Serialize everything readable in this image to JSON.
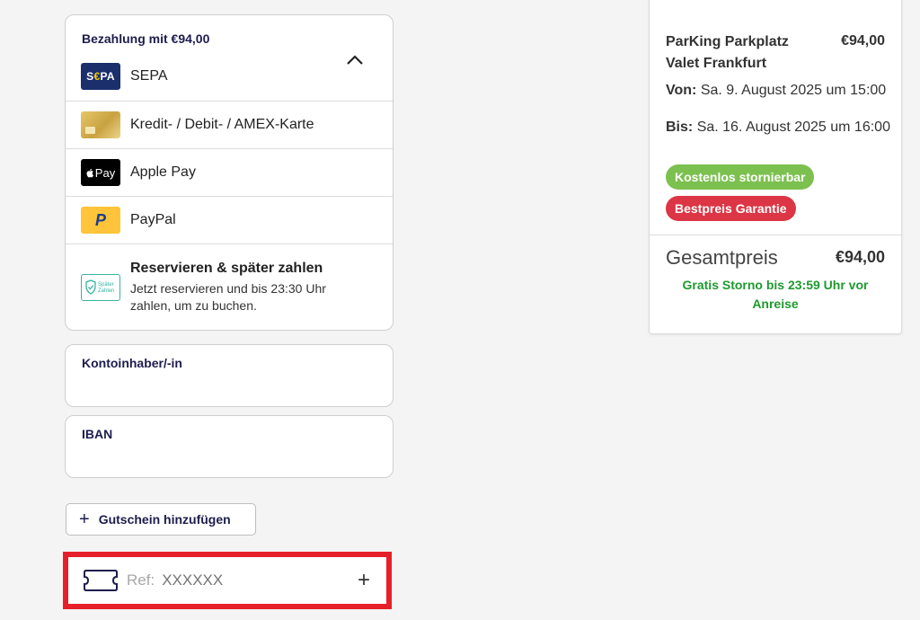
{
  "payment": {
    "title": "Bezahlung mit €94,00",
    "methods": [
      {
        "label": "SEPA",
        "icon": "sepa-logo"
      },
      {
        "label": "Kredit- / Debit- / AMEX-Karte",
        "icon": "credit-card-icon"
      },
      {
        "label": "Apple Pay",
        "icon": "apple-pay-logo"
      },
      {
        "label": "PayPal",
        "icon": "paypal-logo"
      }
    ],
    "sepa_logo_text": "S€PA",
    "apple_logo_text": "Pay",
    "paypal_logo_text": "P",
    "later": {
      "title": "Reservieren & später zahlen",
      "description": "Jetzt reservieren und bis 23:30 Uhr zahlen, um zu buchen.",
      "logo_text_1": "Später",
      "logo_text_2": "Zahlen"
    }
  },
  "fields": {
    "account_holder_label": "Kontoinhaber/-in",
    "account_holder_value": "",
    "iban_label": "IBAN",
    "iban_value": ""
  },
  "voucher": {
    "plus": "+",
    "label": "Gutschein hinzufügen"
  },
  "reference": {
    "prefix": "Ref:",
    "placeholder": "XXXXXX",
    "plus": "+"
  },
  "summary": {
    "name": "ParKing Parkplatz Valet Frankfurt",
    "price": "€94,00",
    "from_label": "Von:",
    "from_value": "Sa. 9. August 2025 um 15:00",
    "to_label": "Bis:",
    "to_value": "Sa. 16. August 2025 um 16:00",
    "badge_cancel": "Kostenlos stornierbar",
    "badge_best": "Bestpreis Garantie",
    "total_label": "Gesamtpreis",
    "total_value": "€94,00",
    "storno_note": "Gratis Storno bis 23:59 Uhr vor Anreise"
  },
  "colors": {
    "accent_navy": "#1d1d4d",
    "badge_green": "#7cc04f",
    "badge_red": "#dc3545",
    "storno_green": "#1e9a2e",
    "highlight_red": "#e6202a"
  }
}
